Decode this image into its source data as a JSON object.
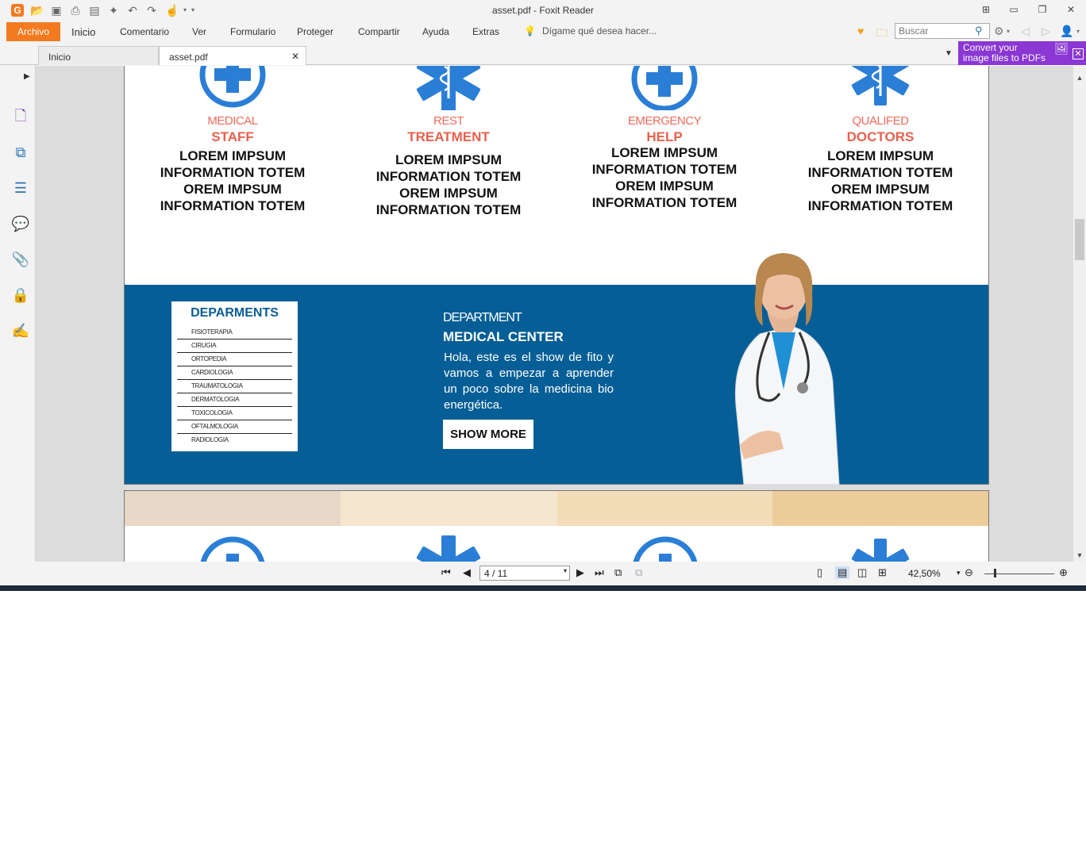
{
  "window": {
    "title": "asset.pdf - Foxit Reader"
  },
  "menu": {
    "file": "Archivo",
    "items": [
      "Inicio",
      "Comentario",
      "Ver",
      "Formulario",
      "Proteger",
      "Compartir",
      "Ayuda",
      "Extras"
    ],
    "tellme": "Dígame qué desea hacer...",
    "search_placeholder": "Buscar"
  },
  "tabs": [
    {
      "label": "Inicio"
    },
    {
      "label": "asset.pdf"
    }
  ],
  "promo": {
    "line1": "Convert your",
    "line2": "image files to PDFs"
  },
  "features": [
    {
      "small": "MEDICAL",
      "big": "STAFF",
      "body": [
        "LOREM IMPSUM",
        "INFORMATION TOTEM",
        "OREM IMPSUM",
        "INFORMATION TOTEM"
      ],
      "icon": "cross-circle-icon"
    },
    {
      "small": "REST",
      "big": "TREATMENT",
      "body": [
        "LOREM IMPSUM",
        "INFORMATION TOTEM",
        "OREM IMPSUM",
        "INFORMATION TOTEM"
      ],
      "icon": "star-of-life-icon"
    },
    {
      "small": "EMERGENCY",
      "big": "HELP",
      "body": [
        "LOREM IMPSUM",
        "INFORMATION TOTEM",
        "OREM IMPSUM",
        "INFORMATION TOTEM"
      ],
      "icon": "cross-circle-icon"
    },
    {
      "small": "QUALIFED",
      "big": "DOCTORS",
      "body": [
        "LOREM IMPSUM",
        "INFORMATION TOTEM",
        "OREM IMPSUM",
        "INFORMATION TOTEM"
      ],
      "icon": "star-of-life-icon"
    }
  ],
  "departments": {
    "title": "DEPARMENTS",
    "items": [
      "FISIOTERAPIA",
      "CIRUGIA",
      "ORTOPEDIA",
      "CARDIOLOGIA",
      "TRAUMATOLOGIA",
      "DERMATOLOGIA",
      "TOXICOLOGIA",
      "OFTALMOLOGIA",
      "RADIOLOGIA"
    ]
  },
  "banner": {
    "small": "DEPARTMENT",
    "big": "MEDICAL CENTER",
    "text": "Hola, este es el show de fito y vamos a empezar a aprender un poco sobre la medicina bio energética.",
    "button": "SHOW MORE"
  },
  "stripe_colors": [
    "#e8d8c8",
    "#f5e6cf",
    "#f3ddb8",
    "#eccc98"
  ],
  "status": {
    "page": "4 / 11",
    "zoom": "42,50%"
  },
  "colors": {
    "accent": "#f47a20",
    "brand_blue": "#055e96",
    "icon_blue": "#2a7ed6",
    "coral": "#e8604e",
    "promo": "#8a37d4"
  }
}
